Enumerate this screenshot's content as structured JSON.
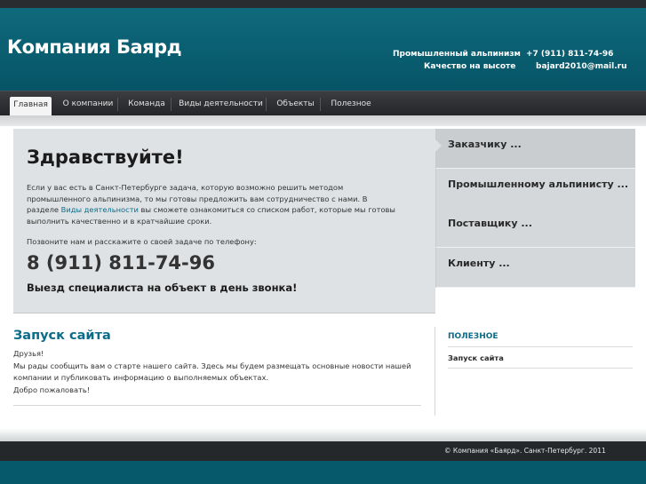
{
  "header": {
    "logo": "Компания Баярд",
    "tagline1": "Промышленный альпинизм",
    "tagline2": "Качество на высоте",
    "phone": "+7 (911) 811-74-96",
    "email": "bajard2010@mail.ru"
  },
  "nav": {
    "items": [
      {
        "label": "Главная"
      },
      {
        "label": "О компании"
      },
      {
        "label": "Команда"
      },
      {
        "label": "Виды деятельности"
      },
      {
        "label": "Объекты"
      },
      {
        "label": "Полезное"
      }
    ]
  },
  "hero": {
    "title": "Здравствуйте!",
    "intro_pre": "Если у вас есть в Санкт-Петербурге задача, которую возможно решить методом промышленного альпинизма, то мы готовы предложить вам сотрудничество с нами. В разделе ",
    "intro_link": "Виды деятельности",
    "intro_post": " вы сможете ознакомиться со списком работ, которые мы готовы выполнить качественно и в кратчайшие сроки.",
    "call_text": "Позвоните нам и расскажите о своей задаче по телефону:",
    "big_phone": "8 (911) 811-74-96",
    "visit_text": "Выезд специалиста на объект в день звонка!"
  },
  "tabs": [
    {
      "label": "Заказчику ..."
    },
    {
      "label": "Промышленному альпинисту ..."
    },
    {
      "label": "Поставщику ..."
    },
    {
      "label": "Клиенту ..."
    }
  ],
  "post": {
    "title": "Запуск сайта",
    "lines": [
      "Друзья!",
      "Мы рады сообщить вам о старте нашего сайта. Здесь мы будем размещать основные новости нашей",
      "компании и публиковать информацию о выполняемых объектах.",
      "Добро пожаловать!"
    ]
  },
  "sidebar": {
    "heading": "ПОЛЕЗНОЕ",
    "link": "Запуск сайта"
  },
  "footer": {
    "copyright": "© Компания «Баярд». Санкт-Петербург. 2011"
  },
  "colors": {
    "brand_teal": "#055466",
    "link": "#0b6d8a"
  }
}
